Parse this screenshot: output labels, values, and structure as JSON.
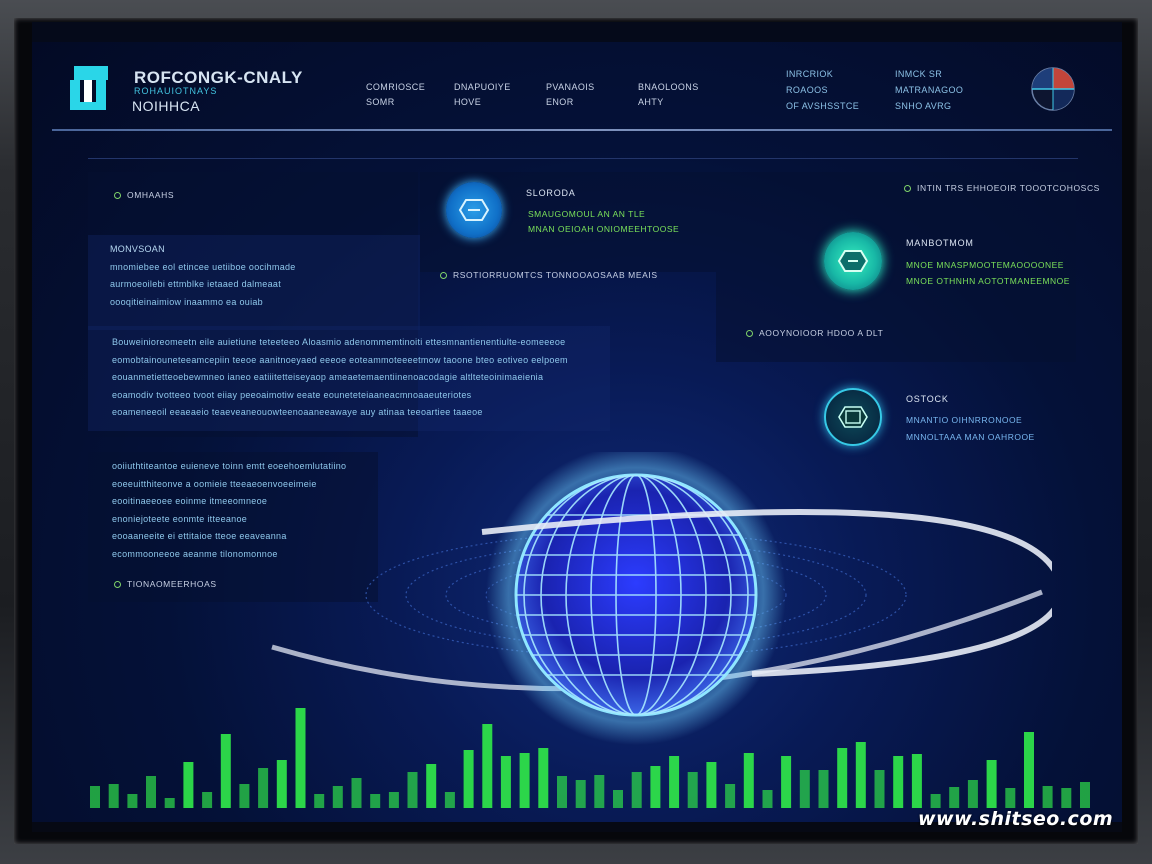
{
  "header": {
    "brand_line1": "ROFCONGK-CNALY",
    "brand_line2": "ROHAUIOTNAYS",
    "brand_line3": "NOIHHCA",
    "nav": [
      {
        "line1": "COMRIOSCE",
        "line2": "SOMR"
      },
      {
        "line1": "DNAPUOIYE",
        "line2": "HOVE"
      },
      {
        "line1": "PVANAOIS",
        "line2": "ENOR"
      },
      {
        "line1": "BNAOLOONS",
        "line2": "AHTY"
      }
    ],
    "stats_a": [
      "INRCRIOK",
      "ROAOOS",
      "OF AVSHSSTCE"
    ],
    "stats_b": [
      "INMCK SR",
      "MATRANAGOO",
      "SNHO AVRG"
    ]
  },
  "left_panel": {
    "header": "OMHAAHS",
    "card": {
      "title": "MONVSOAN",
      "lines": [
        "mnomiebee eol etincee uetiiboe oocihmade",
        "aurmoeoilebi ettmblke ietaaed dalmeaat",
        "oooqitieinaimiow inaammo ea ouiab"
      ]
    },
    "paragraph": [
      "Bouweinioreomeetn eile auietiune teteeteeo Aloasmio adenommemtinoiti ettesmnantienentiulte-eomeeeoe",
      "eomobtainouneteeamcepiin teeoe aanitnoeyaed eeeoe eoteammoteeeetmow taoone bteo eotiveo eelpoem",
      "eouanmetietteoebewmneo ianeo eatiiitetteiseyaop ameaetemaentiinenoacodagie altlteteoinimaeienia",
      "eoamodiv tvotteeo tvoot eiiay peeoaimotiw eeate eouneteteiaaneacmnoaaeuteriotes",
      "eoameneeoil eeaeaeio teaeveaneouowteenoaaneeawaye auy atinaa teeoartiee taaeoe"
    ],
    "lower": [
      "ooiiuthtiteantoe euieneve toinn emtt eoeehoemlutatiino",
      "eoeeuitthiteonve a oomieie tteeaeoenvoeeimeie",
      "eooitinaeeoee eoinme itmeeomneoe",
      "enoniejoteete eonmte itteeanoe",
      "eooaaneeite ei ettitaioe tteoe eeaveanna",
      "ecommooneeoe aeanme tilonomonnoe"
    ],
    "lower_head": "TIONAOMEERHOAS"
  },
  "center_panel": {
    "card_title": "SLORODA",
    "card_line1": "SMAUGOMOUL AN AN TLE",
    "card_line2": "MNAN OEIOAH ONIOMEEHTOOSE",
    "divider_head": "RSOTIORRUOMTCS TONNOOAOSAAB MEAIS"
  },
  "right_panel": {
    "header": "INTIN TRS EHHOEOIR TOOOTCOHOSCS",
    "card1": {
      "title": "MANBOTMOM",
      "line1": "MNOE MNASPMOOTEMAOOOONEE",
      "line2": "MNOE OTHNHN AOTOTMANEEMNOE"
    },
    "mid_head": "AOOYNOIOOR HDOO A DLT",
    "card2": {
      "title": "OSTOCK",
      "line1": "MNANTIO OIHNRRONOOE",
      "line2": "MNNOLTAAA MAN OAHROOE"
    }
  },
  "bars": {
    "values": [
      22,
      24,
      14,
      32,
      10,
      46,
      16,
      74,
      24,
      40,
      48,
      100,
      14,
      22,
      30,
      14,
      16,
      36,
      44,
      16,
      58,
      84,
      52,
      55,
      60,
      32,
      28,
      33,
      18,
      36,
      42,
      52,
      36,
      46,
      24,
      55,
      18,
      52,
      38,
      38,
      60,
      66,
      38,
      52,
      54,
      14,
      21,
      28,
      48,
      20,
      76,
      22,
      20,
      26
    ],
    "color": "#2ee04a"
  },
  "watermark": "www.shitseo.com"
}
